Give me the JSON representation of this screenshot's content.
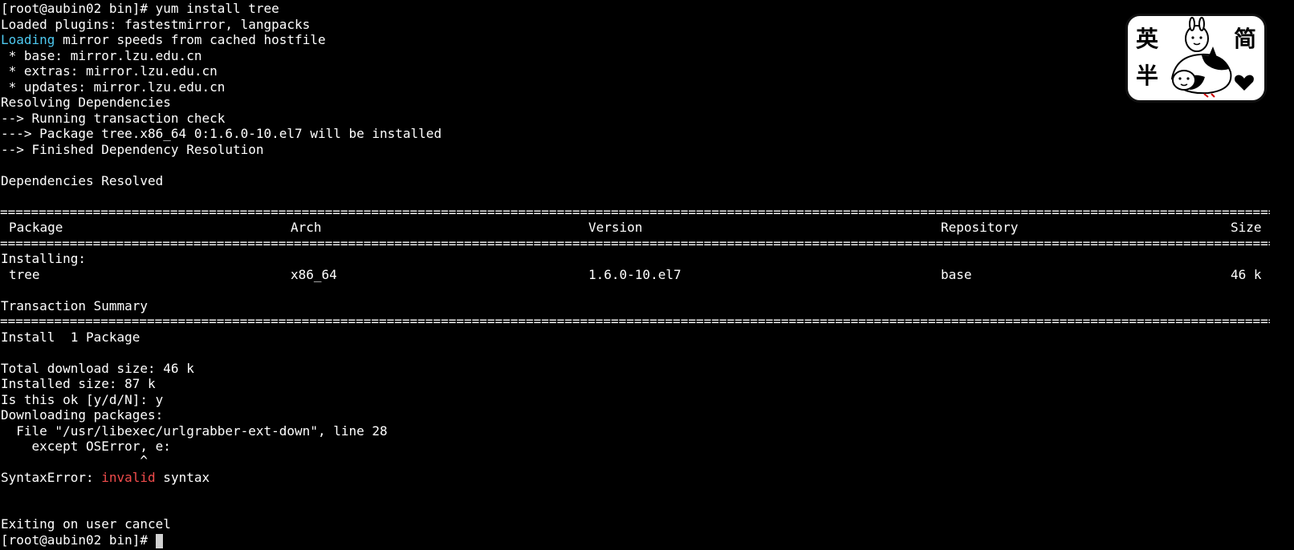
{
  "terminal": {
    "lines": {
      "l00": "[root@aubin02 bin]# yum install tree",
      "l01": "Loaded plugins: fastestmirror, langpacks",
      "l02a": "Loading",
      "l02b": " mirror speeds from cached hostfile",
      "l03": " * base: mirror.lzu.edu.cn",
      "l04": " * extras: mirror.lzu.edu.cn",
      "l05": " * updates: mirror.lzu.edu.cn",
      "l06": "Resolving Dependencies",
      "l07": "--> Running transaction check",
      "l08": "---> Package tree.x86_64 0:1.6.0-10.el7 will be installed",
      "l09": "--> Finished Dependency Resolution",
      "l11": "Dependencies Resolved",
      "l16": "Installing:",
      "l19": "Transaction Summary",
      "l21": "Install  1 Package",
      "l23": "Total download size: 46 k",
      "l24": "Installed size: 87 k",
      "l25": "Is this ok [y/d/N]: y",
      "l26": "Downloading packages:",
      "l27": "  File \"/usr/libexec/urlgrabber-ext-down\", line 28",
      "l28": "    except OSError, e:",
      "l29": "                  ^",
      "l30a": "SyntaxError: ",
      "l30b": "invalid",
      "l30c": " syntax",
      "l33": "Exiting on user cancel",
      "l34": "[root@aubin02 bin]# "
    },
    "table": {
      "headers": [
        "Package",
        "Arch",
        "Version",
        "Repository",
        "Size"
      ],
      "row": [
        "tree",
        "x86_64",
        "1.6.0-10.el7",
        "base",
        "46 k"
      ]
    },
    "separator": "================================================================================================================================================================================="
  },
  "sticker": {
    "chars": [
      "英",
      "简",
      "半"
    ],
    "icon": "cartoon-cats-sticker"
  },
  "colors": {
    "background": "#000000",
    "text": "#ffffff",
    "loading": "#4ec9f0",
    "error": "#f14c4c"
  }
}
